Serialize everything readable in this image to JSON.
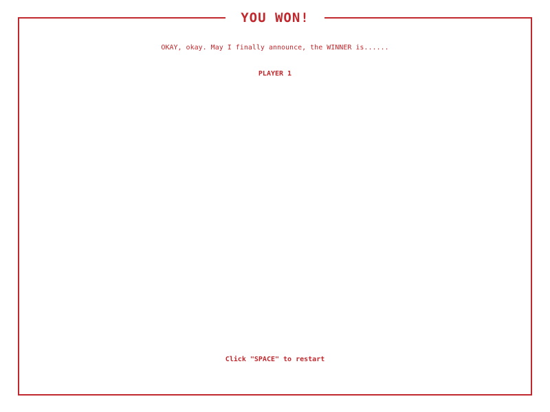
{
  "colors": {
    "accent": "#c0282d",
    "background": "#ffffff"
  },
  "screen": {
    "title": "YOU WON!",
    "announcement": "OKAY, okay. May I finally announce, the WINNER is......",
    "winner": "PLAYER 1",
    "restart_hint": "Click \"SPACE\" to restart"
  }
}
